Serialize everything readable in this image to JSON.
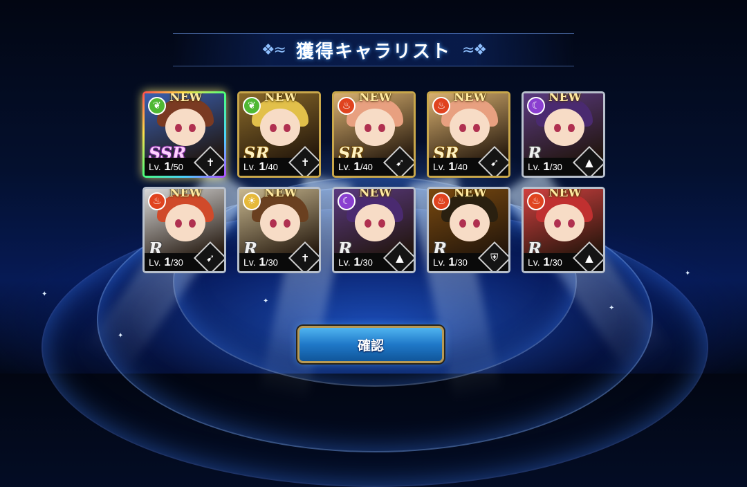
{
  "title": "獲得キャラリスト",
  "confirm_label": "確認",
  "new_label": "NEW",
  "level_prefix": "Lv.",
  "colors": {
    "earth": "#4fb833",
    "fire": "#e0431f",
    "dark": "#8a3fd0",
    "light": "#e6b93a",
    "gold_frame": "#c9a74a",
    "silver_frame": "#b8c0cc",
    "button": "#1f78c8"
  },
  "characters": [
    {
      "element": "earth",
      "element_icon": "leaf-icon",
      "rarity": "SSR",
      "level": "1",
      "max": "/50",
      "weapon": "cross-icon",
      "weapon_glyph": "✝",
      "frame": "ssr",
      "bg": "#3a5fb0",
      "hair": "#7a3a22"
    },
    {
      "element": "earth",
      "element_icon": "leaf-icon",
      "rarity": "SR",
      "level": "1",
      "max": "/40",
      "weapon": "sword-icon",
      "weapon_glyph": "✝",
      "frame": "gold",
      "bg": "#8a6a2a",
      "hair": "#e2c04a"
    },
    {
      "element": "fire",
      "element_icon": "flame-icon",
      "rarity": "SR",
      "level": "1",
      "max": "/40",
      "weapon": "bow-icon",
      "weapon_glyph": "➹",
      "frame": "gold",
      "bg": "#d8b070",
      "hair": "#e8a080"
    },
    {
      "element": "fire",
      "element_icon": "flame-icon",
      "rarity": "SR",
      "level": "1",
      "max": "/40",
      "weapon": "bow-icon",
      "weapon_glyph": "➹",
      "frame": "gold",
      "bg": "#d8b070",
      "hair": "#e8a080"
    },
    {
      "element": "dark",
      "element_icon": "moon-icon",
      "rarity": "R",
      "level": "1",
      "max": "/30",
      "weapon": "wizard-hat-icon",
      "weapon_glyph": "▲",
      "frame": "silver",
      "bg": "#5a3a80",
      "hair": "#4a2a70"
    },
    {
      "element": "fire",
      "element_icon": "flame-icon",
      "rarity": "R",
      "level": "1",
      "max": "/30",
      "weapon": "bow-icon",
      "weapon_glyph": "➹",
      "frame": "silver",
      "bg": "#d8d8d8",
      "hair": "#d04a2a"
    },
    {
      "element": "light",
      "element_icon": "sun-icon",
      "rarity": "R",
      "level": "1",
      "max": "/30",
      "weapon": "cross-icon",
      "weapon_glyph": "✝",
      "frame": "silver",
      "bg": "#c8b890",
      "hair": "#6a4020"
    },
    {
      "element": "dark",
      "element_icon": "moon-icon",
      "rarity": "R",
      "level": "1",
      "max": "/30",
      "weapon": "wizard-hat-icon",
      "weapon_glyph": "▲",
      "frame": "silver",
      "bg": "#5a3a80",
      "hair": "#4a2a70"
    },
    {
      "element": "fire",
      "element_icon": "flame-icon",
      "rarity": "R",
      "level": "1",
      "max": "/30",
      "weapon": "shield-icon",
      "weapon_glyph": "⛨",
      "frame": "silver",
      "bg": "#7a4a10",
      "hair": "#2a2010"
    },
    {
      "element": "fire",
      "element_icon": "flame-icon",
      "rarity": "R",
      "level": "1",
      "max": "/30",
      "weapon": "wizard-hat-icon",
      "weapon_glyph": "▲",
      "frame": "silver",
      "bg": "#d04040",
      "hair": "#c03030"
    }
  ]
}
